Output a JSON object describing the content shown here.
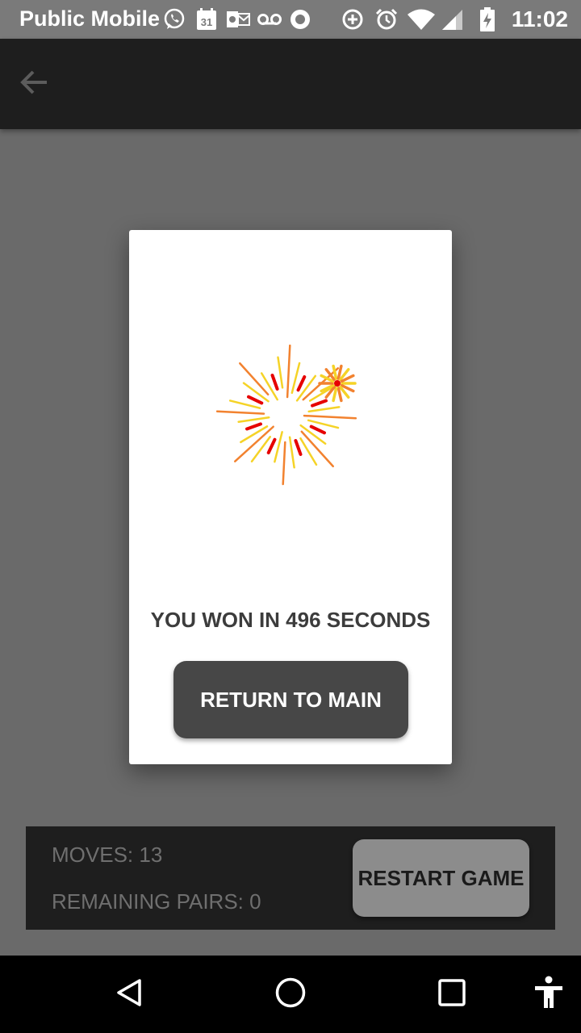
{
  "status_bar": {
    "carrier": "Public Mobile",
    "calendar_day": "31",
    "time": "11:02",
    "icons": [
      "whatsapp-icon",
      "calendar-icon",
      "outlook-icon",
      "voicemail-icon",
      "record-icon",
      "data-saver-icon",
      "alarm-icon",
      "wifi-icon",
      "signal-icon",
      "battery-charging-icon"
    ]
  },
  "app_bar": {
    "back_icon": "arrow-back-icon"
  },
  "dialog": {
    "image": "fireworks-icon",
    "message": "YOU WON IN 496 SECONDS",
    "return_label": "RETURN TO MAIN"
  },
  "game_panel": {
    "moves": "MOVES: 13",
    "remaining_pairs": "REMAINING PAIRS: 0",
    "restart_label": "RESTART GAME"
  },
  "nav_bar": {
    "icons": [
      "back-triangle-icon",
      "home-circle-icon",
      "recents-square-icon",
      "accessibility-icon"
    ]
  },
  "colors": {
    "overlay": "#6a6a6a",
    "app_bar": "#1e1e1e",
    "button_dark": "#474747",
    "button_light": "#8c8c8c",
    "firework_red": "#e60000",
    "firework_yellow": "#f5d327",
    "firework_orange": "#f2822f"
  }
}
